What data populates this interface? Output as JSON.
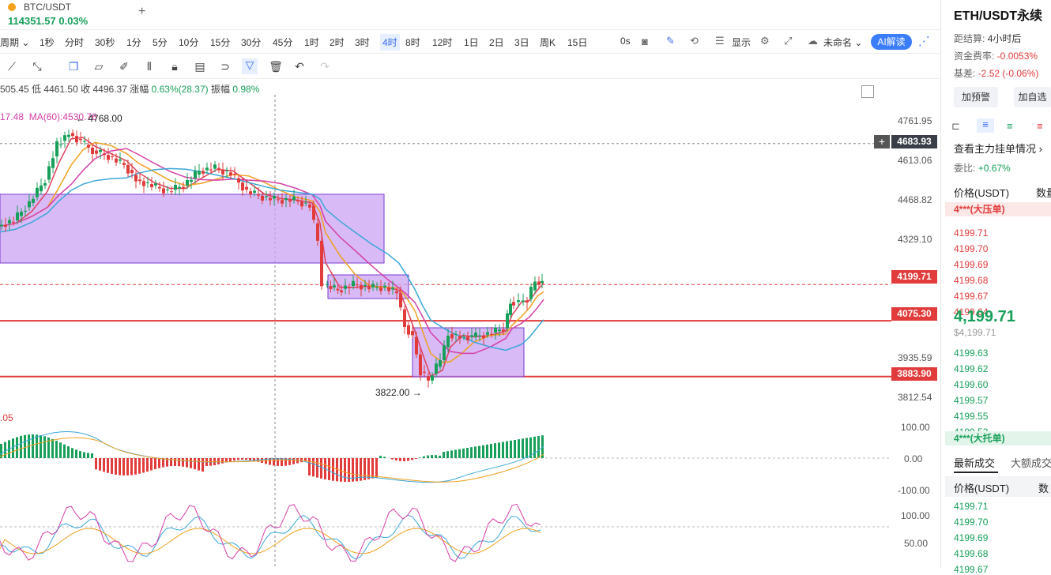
{
  "tab": {
    "pair": "BTC/USDT",
    "price": "114351.57",
    "change": "0.03%"
  },
  "timeframes": [
    {
      "label": "周期 ⌄",
      "active": false
    },
    {
      "label": "1秒",
      "active": false
    },
    {
      "label": "分时",
      "active": false
    },
    {
      "label": "30秒",
      "active": false
    },
    {
      "label": "1分",
      "active": false
    },
    {
      "label": "5分",
      "active": false
    },
    {
      "label": "10分",
      "active": false
    },
    {
      "label": "15分",
      "active": false
    },
    {
      "label": "30分",
      "active": false
    },
    {
      "label": "45分",
      "active": false
    },
    {
      "label": "1时",
      "active": false
    },
    {
      "label": "2时",
      "active": false
    },
    {
      "label": "3时",
      "active": false
    },
    {
      "label": "4时",
      "active": true
    },
    {
      "label": "8时",
      "active": false
    },
    {
      "label": "12时",
      "active": false
    },
    {
      "label": "1日",
      "active": false
    },
    {
      "label": "2日",
      "active": false
    },
    {
      "label": "3日",
      "active": false
    },
    {
      "label": "周K",
      "active": false
    },
    {
      "label": "15日",
      "active": false
    }
  ],
  "toolbar_right": {
    "seconds": "0s",
    "display": "显示",
    "unnamed": "未命名 ⌄",
    "ai": "AI解读"
  },
  "ohlc": {
    "open_tail": "505.45",
    "low_label": "低",
    "low": "4461.50",
    "close_label": "收",
    "close": "4496.37",
    "chg_label": "涨幅",
    "chg": "0.63%(28.37)",
    "amp_label": "振幅",
    "amp": "0.98%"
  },
  "ma": {
    "ma_tail": "17.48",
    "ma60": "MA(60):4530.76",
    "high_mark": "4768.00"
  },
  "chart_annotations": {
    "low_mark": "3822.00 →",
    "macd_tail": ".05"
  },
  "price_axis": [
    "4761.95",
    "4613.06",
    "4468.82",
    "4329.10",
    "3935.59",
    "3812.54"
  ],
  "price_tags": {
    "crosshair": "4683.93",
    "last": "4199.71",
    "level1": "4075.30",
    "level2": "3883.90"
  },
  "macd_axis": [
    "100.00",
    "0.00",
    "-100.00"
  ],
  "kdj_axis": [
    "100.00",
    "50.00"
  ],
  "panel": {
    "title": "ETH/USDT永续",
    "settle_label": "距结算:",
    "settle_value": "4小时后",
    "funding_label": "资金费率:",
    "funding_value": "-0.0053%",
    "basis_label": "基差:",
    "basis_value": "-2.52 (-0.06%)",
    "alert_btn": "加预警",
    "fav_btn": "加自选",
    "orders_link": "查看主力挂单情况",
    "ratio_label": "委比:",
    "ratio_value": "+0.67%",
    "price_col": "价格(USDT)",
    "qty_col": "数量",
    "big_ask": "4***(大压单)",
    "asks": [
      "4199.71",
      "4199.70",
      "4199.69",
      "4199.68",
      "4199.67",
      "4199.64"
    ],
    "last_price": "4,199.71",
    "last_usd": "$4,199.71",
    "bids": [
      "4199.63",
      "4199.62",
      "4199.60",
      "4199.57",
      "4199.55",
      "4199.53"
    ],
    "big_bid": "4***(大托单)",
    "trades_tab": "最新成交",
    "big_trades_tab": "大额成交",
    "trades_price_col": "价格(USDT)",
    "trades_qty_col": "数",
    "trades": [
      "4199.71",
      "4199.70",
      "4199.69",
      "4199.68",
      "4199.67"
    ]
  },
  "colors": {
    "up": "#18a05a",
    "down": "#e23b3b",
    "accent": "#3b7dfc",
    "box": "#c9a3f3"
  }
}
